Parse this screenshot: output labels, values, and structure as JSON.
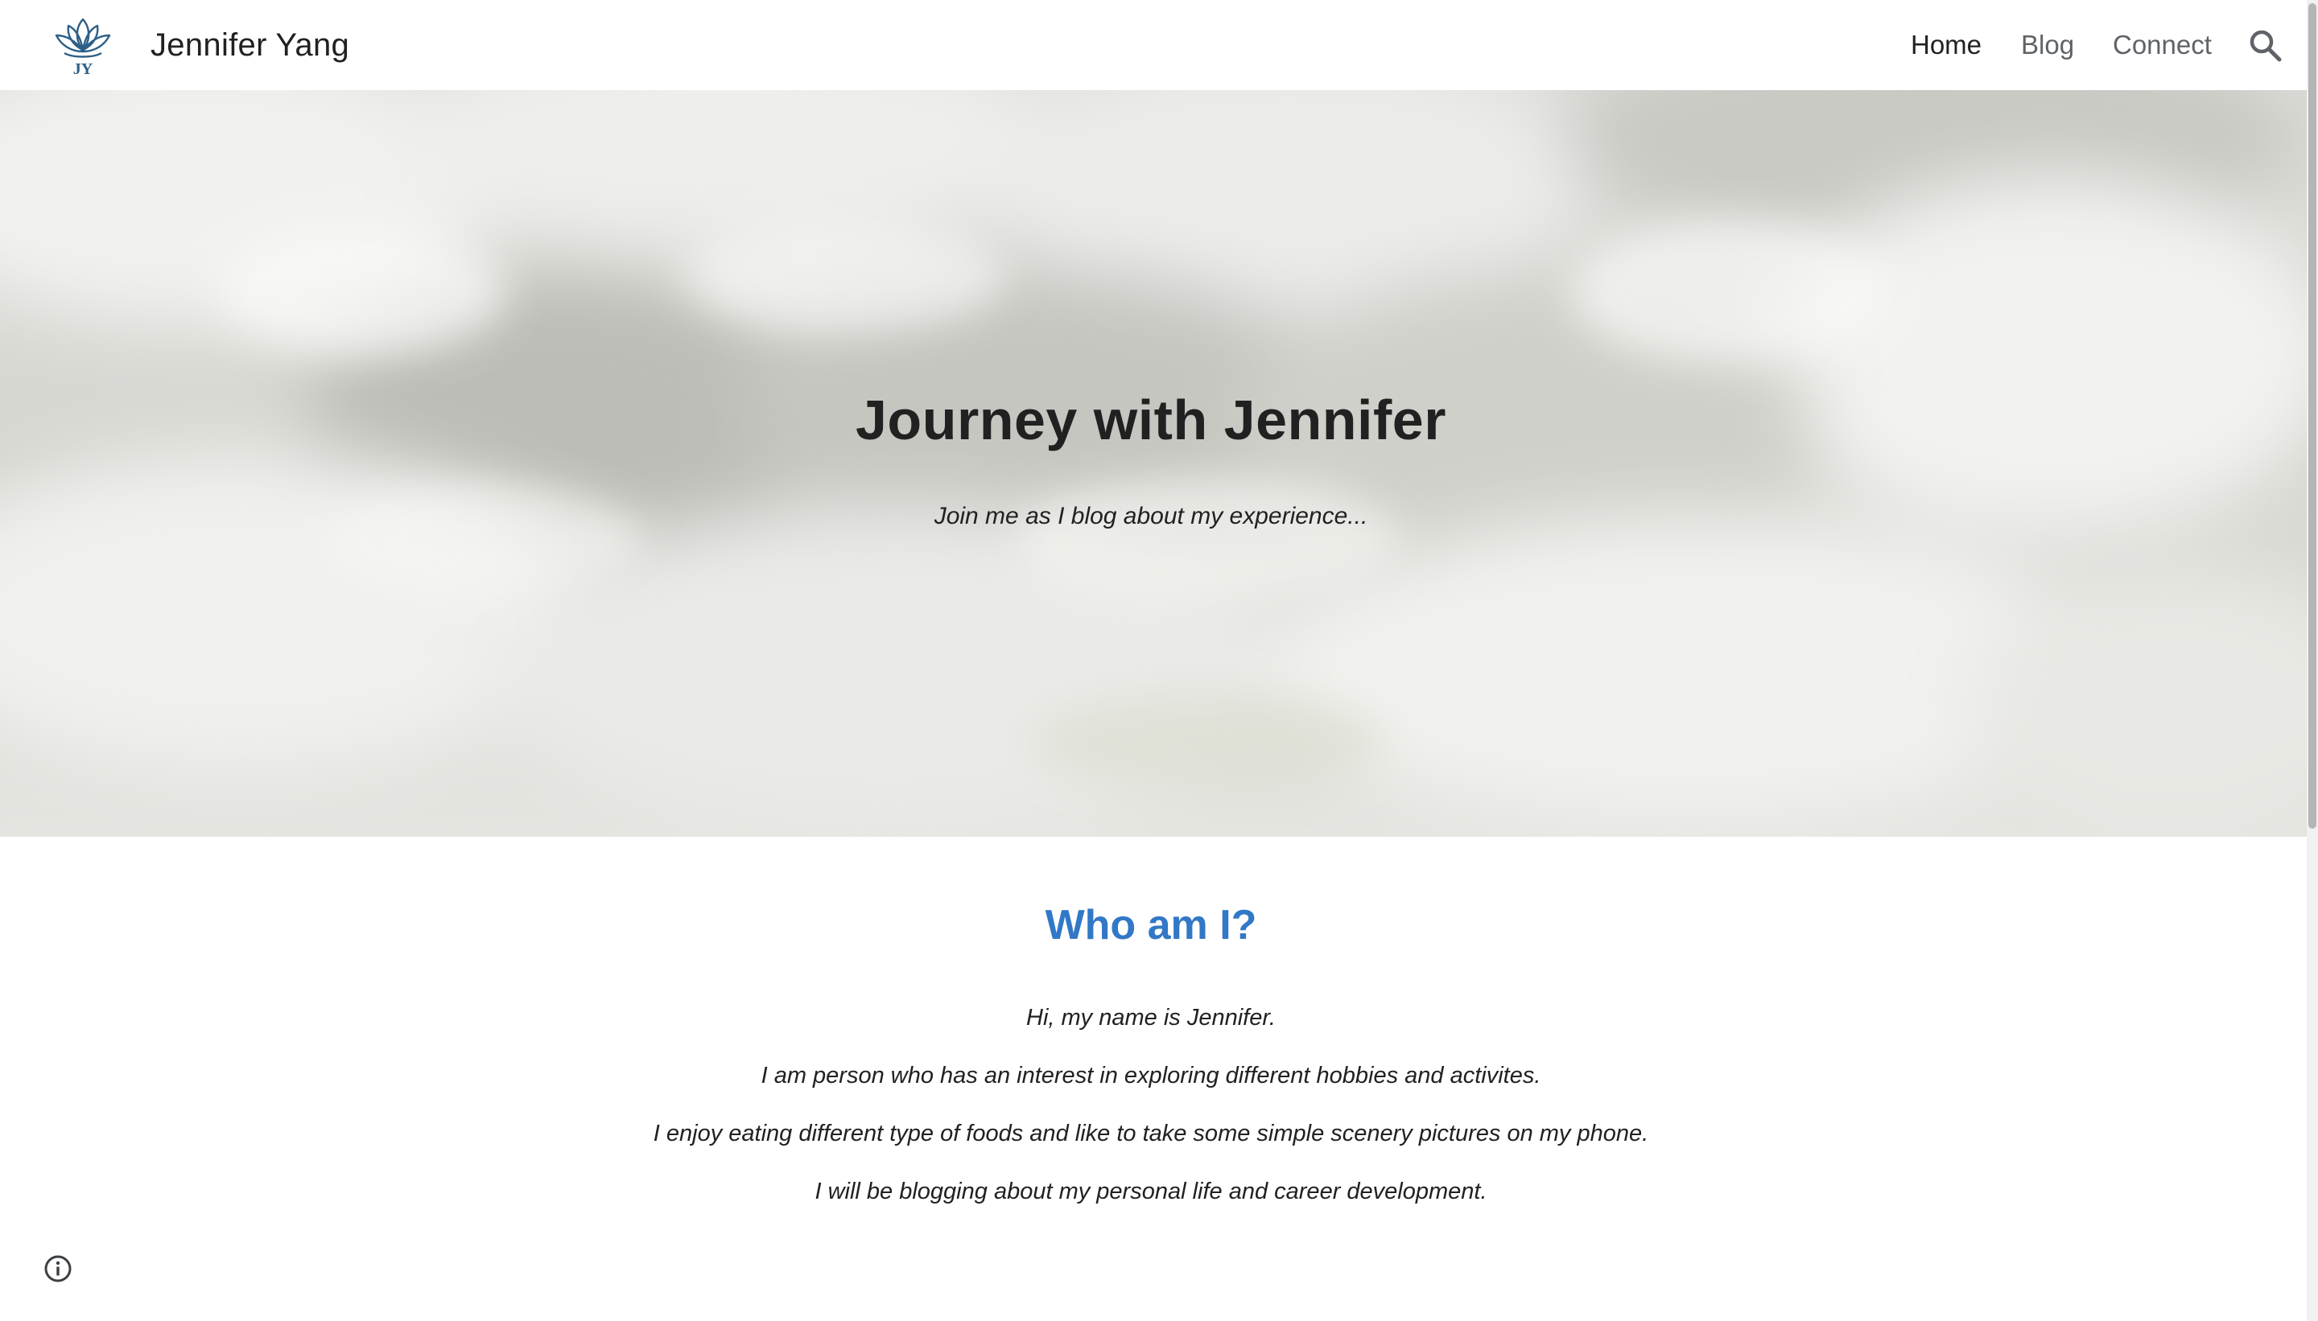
{
  "header": {
    "logo_text": "JY",
    "site_title": "Jennifer Yang",
    "nav": [
      {
        "label": "Home",
        "active": true
      },
      {
        "label": "Blog",
        "active": false
      },
      {
        "label": "Connect",
        "active": false
      }
    ],
    "search_icon": "search-icon"
  },
  "hero": {
    "title": "Journey with Jennifer",
    "subtitle": "Join me as I blog about my experience..."
  },
  "about": {
    "heading": "Who am I?",
    "paragraphs": [
      "Hi, my name is Jennifer.",
      "I am person who has an interest in exploring different hobbies and activites.",
      "I enjoy eating different type of foods and like to take some simple scenery pictures on my phone.",
      "I will be blogging about my personal life and career development."
    ]
  },
  "footer": {
    "info_icon": "info-icon"
  },
  "colors": {
    "accent": "#3178c6",
    "text": "#212121",
    "nav_inactive": "#5f6368"
  }
}
